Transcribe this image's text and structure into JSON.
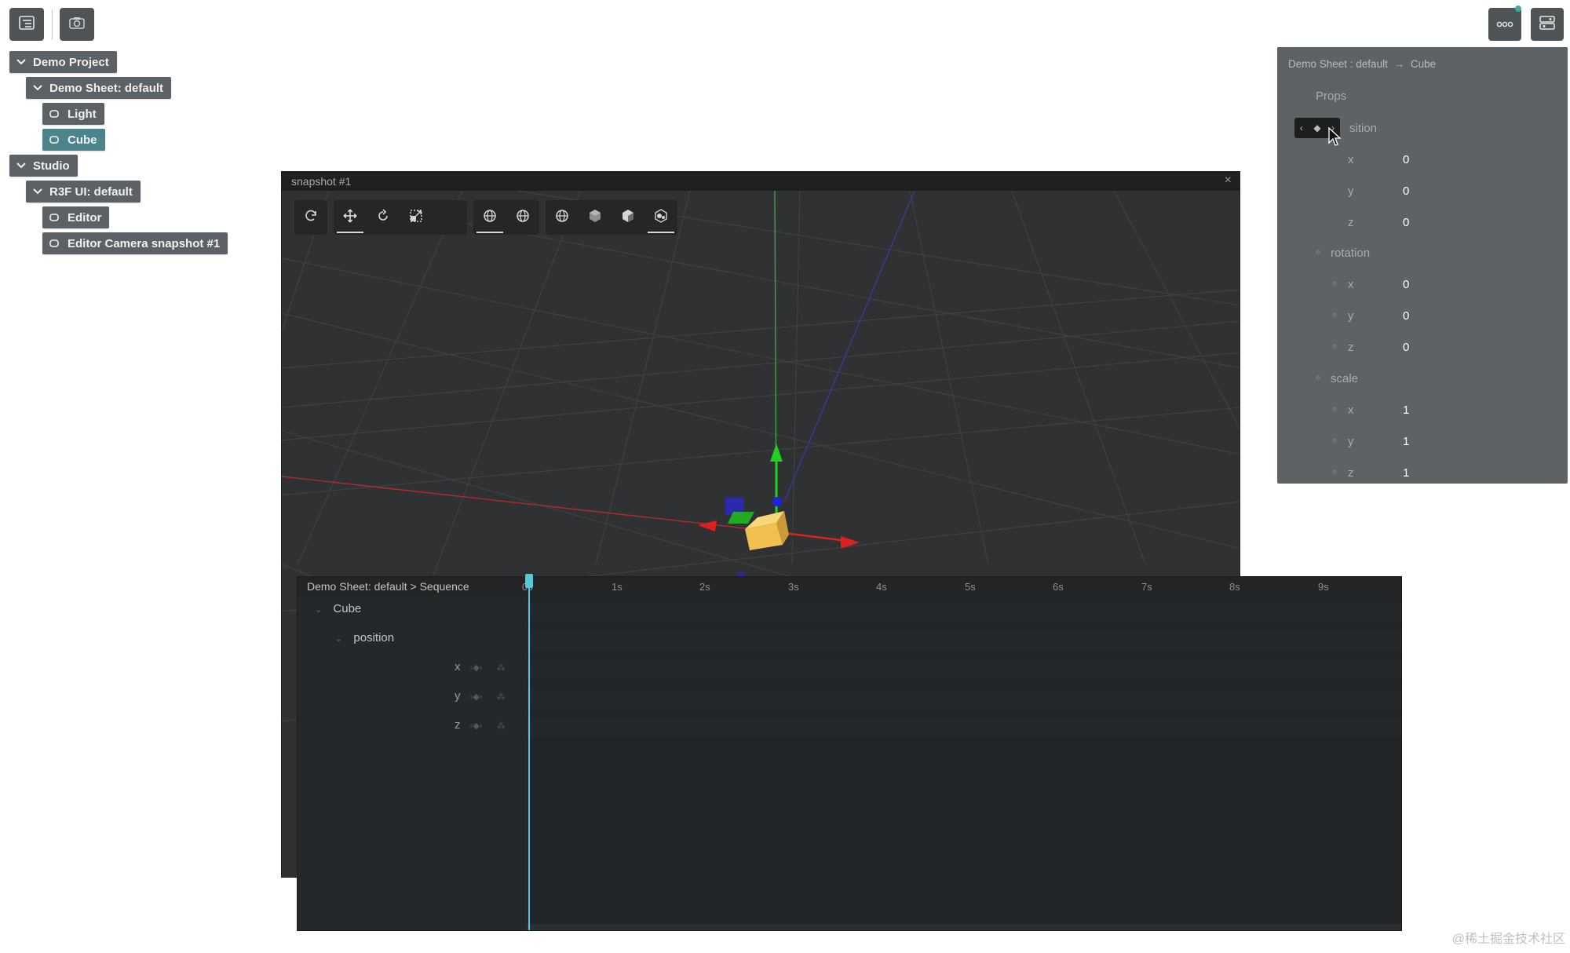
{
  "toolbar": {
    "outline_icon": "outline-panel-icon",
    "snapshot_icon": "camera-icon",
    "more_icon": "more-dots-icon",
    "props_toggle_icon": "panel-toggle-icon"
  },
  "outline": {
    "items": [
      {
        "label": "Demo Project"
      },
      {
        "label": "Demo Sheet: default"
      },
      {
        "label": "Light"
      },
      {
        "label": "Cube"
      },
      {
        "label": "Studio"
      },
      {
        "label": "R3F UI: default"
      },
      {
        "label": "Editor"
      },
      {
        "label": "Editor Camera snapshot #1"
      }
    ]
  },
  "viewport": {
    "title": "snapshot #1",
    "close_glyph": "×"
  },
  "props": {
    "crumb_sheet": "Demo Sheet : default",
    "crumb_arrow": "→",
    "crumb_object": "Cube",
    "props_label": "Props",
    "position_label": "sition",
    "rotation_label": "rotation",
    "scale_label": "scale",
    "position": {
      "x_label": "x",
      "x": "0",
      "y_label": "y",
      "y": "0",
      "z_label": "z",
      "z": "0"
    },
    "rotation": {
      "x_label": "x",
      "x": "0",
      "y_label": "y",
      "y": "0",
      "z_label": "z",
      "z": "0"
    },
    "scale": {
      "x_label": "x",
      "x": "1",
      "y_label": "y",
      "y": "1",
      "z_label": "z",
      "z": "1"
    }
  },
  "timeline": {
    "crumb": "Demo Sheet: default > Sequence",
    "ticks": [
      "0s",
      "1s",
      "2s",
      "3s",
      "4s",
      "5s",
      "6s",
      "7s",
      "8s",
      "9s"
    ],
    "object": "Cube",
    "prop": "position",
    "tracks": [
      "x",
      "y",
      "z"
    ]
  },
  "watermark": "@稀土掘金技术社区",
  "colors": {
    "accent": "#4fc3d8",
    "selected": "#4c848c",
    "axis_x": "#e02020",
    "axis_y": "#22d022",
    "axis_z": "#2020e0",
    "cube": "#e8b94a"
  }
}
